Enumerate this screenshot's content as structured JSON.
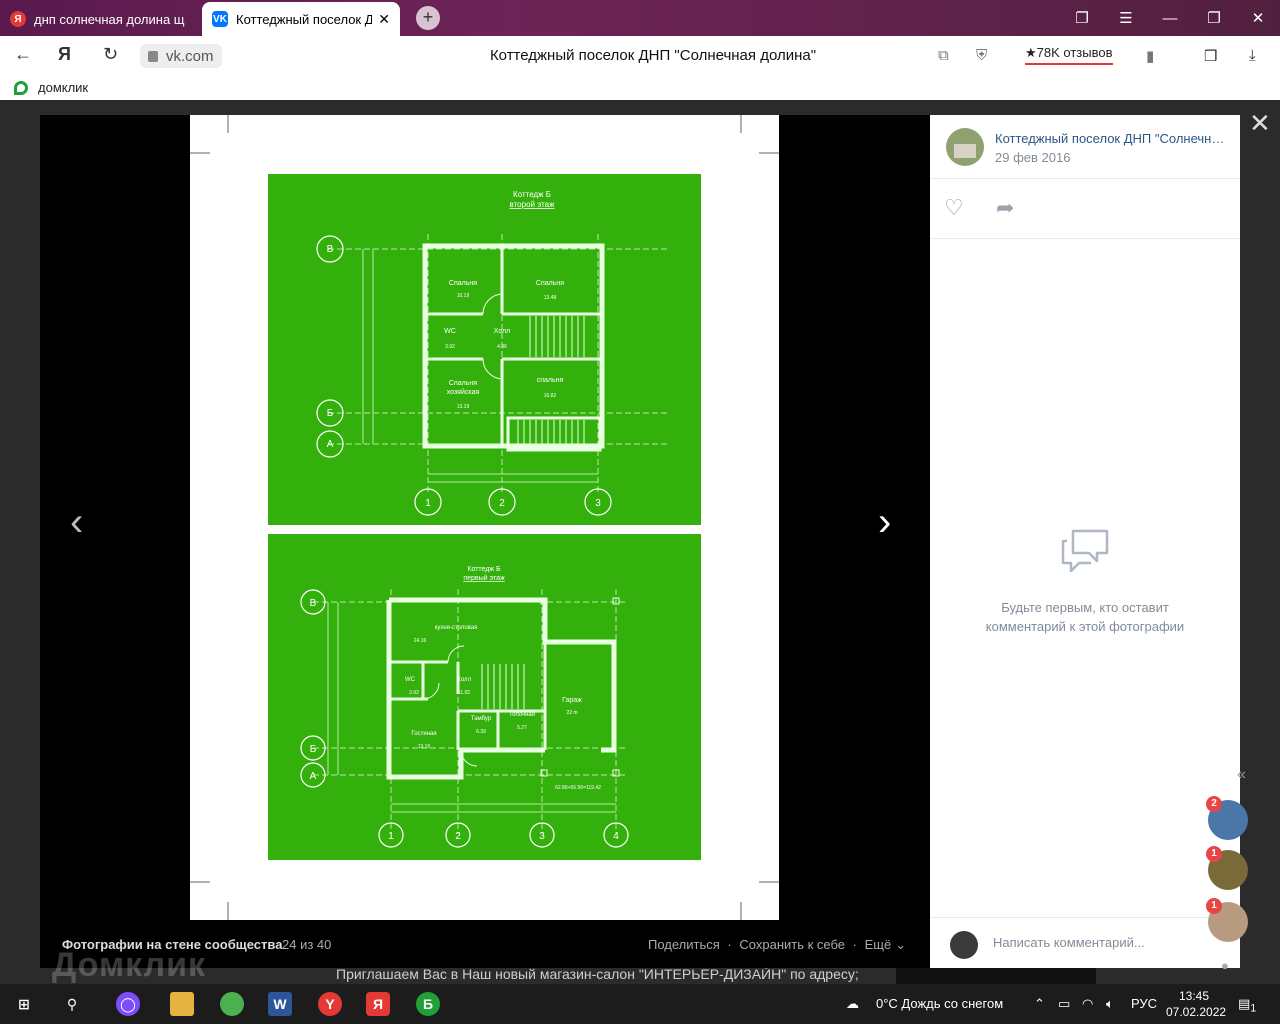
{
  "browser": {
    "tabs": [
      {
        "label": "днп солнечная долина щ",
        "icon": "yandex-icon",
        "active": false
      },
      {
        "label": "Коттеджный поселок Д",
        "icon": "vk-icon",
        "active": true
      }
    ],
    "url": "vk.com",
    "page_title": "Коттеджный поселок ДНП \"Солнечная долина\"",
    "reviews": "78K отзывов",
    "bookmark": "домклик"
  },
  "viewer": {
    "album_title": "Фотографии на стене сообщества",
    "counter": "24 из 40",
    "share": "Поделиться",
    "save": "Сохранить к себе",
    "more": "Ещё",
    "plan_top": {
      "title1": "Коттедж Б",
      "title2": "второй этаж",
      "axes_rows": [
        "В",
        "Б",
        "А"
      ],
      "axes_cols": [
        "1",
        "2",
        "3"
      ],
      "rooms": [
        {
          "name": "Спальня",
          "area": "10.19"
        },
        {
          "name": "Спальня",
          "area": "13.48"
        },
        {
          "name": "WC",
          "area": "3.92"
        },
        {
          "name": "Холл",
          "area": "4.96"
        },
        {
          "name": "Спальня",
          "name2": "хозяйская",
          "area": "13.19"
        },
        {
          "name": "спальня",
          "area": "16.82"
        }
      ]
    },
    "plan_bottom": {
      "title1": "Коттедж Б",
      "title2": "первый этаж",
      "axes_rows": [
        "В",
        "Б",
        "А"
      ],
      "axes_cols": [
        "1",
        "2",
        "3",
        "4"
      ],
      "rooms": [
        {
          "name": "кухня-столовая",
          "area": "24.16"
        },
        {
          "name": "WC",
          "area": "3.92"
        },
        {
          "name": "Холл",
          "area": "11.02"
        },
        {
          "name": "Тамбур",
          "area": "6.39"
        },
        {
          "name": "Топочная",
          "area": "5.27"
        },
        {
          "name": "Гараж",
          "area": "22 m"
        },
        {
          "name": "Гостиная",
          "area": "13.16"
        }
      ],
      "total": "62.86+56.56=119.42"
    }
  },
  "panel": {
    "group_name": "Коттеджный поселок ДНП \"Солнечная долина\"",
    "date": "29 фев 2016",
    "empty_text": "Будьте первым, кто оставит комментарий к этой фотографии",
    "comment_placeholder": "Написать комментарий..."
  },
  "chats": [
    {
      "badge": "2",
      "color": "#4a76a8"
    },
    {
      "badge": "1",
      "color": "#7a6a3a"
    },
    {
      "badge": "1",
      "color": "#b89a80"
    }
  ],
  "page": {
    "bottom_text": "Приглашаем Вас в Наш новый магазин-салон \"ИНТЕРЬЕР-ДИЗАЙН\" по адресу;",
    "watermark": "Домклик"
  },
  "taskbar": {
    "weather": "0°С  Дождь со снегом",
    "lang": "РУС",
    "time": "13:45",
    "date": "07.02.2022",
    "notif_count": "1"
  }
}
